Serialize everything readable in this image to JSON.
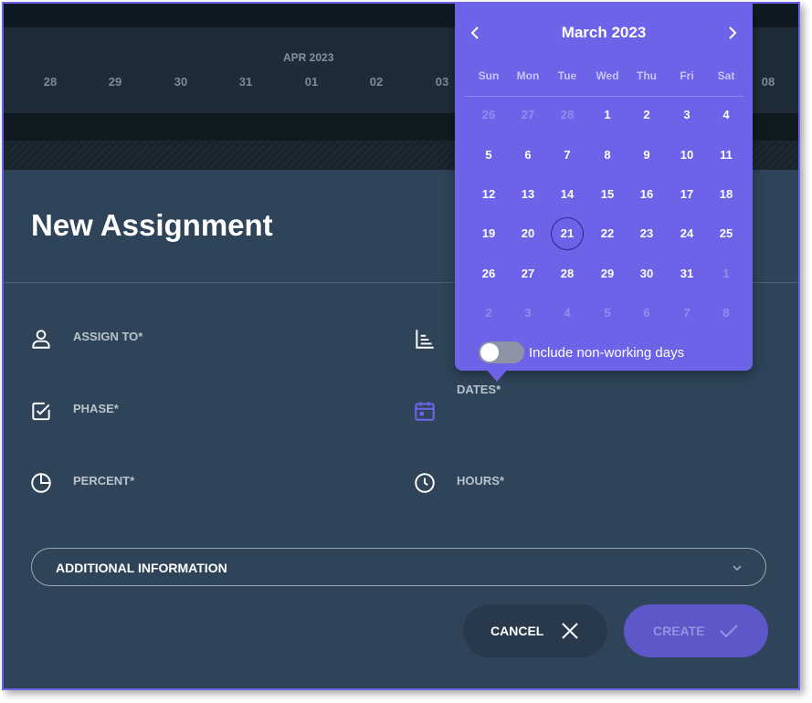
{
  "timeline": {
    "month": "APR 2023",
    "days": [
      "28",
      "29",
      "30",
      "31",
      "01",
      "02",
      "03",
      "08"
    ]
  },
  "form": {
    "title": "New Assignment",
    "fields": {
      "assign_to": "ASSIGN TO*",
      "phase": "PHASE*",
      "percent": "PERCENT*",
      "dates": "DATES*",
      "hours": "HOURS*"
    },
    "additional_info": "ADDITIONAL INFORMATION",
    "cancel_label": "CANCEL",
    "create_label": "CREATE"
  },
  "calendar": {
    "month_title": "March 2023",
    "weekdays": [
      "Sun",
      "Mon",
      "Tue",
      "Wed",
      "Thu",
      "Fri",
      "Sat"
    ],
    "weeks": [
      [
        {
          "d": "26",
          "m": true
        },
        {
          "d": "27",
          "m": true
        },
        {
          "d": "28",
          "m": true
        },
        {
          "d": "1"
        },
        {
          "d": "2"
        },
        {
          "d": "3"
        },
        {
          "d": "4"
        }
      ],
      [
        {
          "d": "5"
        },
        {
          "d": "6"
        },
        {
          "d": "7"
        },
        {
          "d": "8"
        },
        {
          "d": "9"
        },
        {
          "d": "10"
        },
        {
          "d": "11"
        }
      ],
      [
        {
          "d": "12"
        },
        {
          "d": "13"
        },
        {
          "d": "14"
        },
        {
          "d": "15"
        },
        {
          "d": "16"
        },
        {
          "d": "17"
        },
        {
          "d": "18"
        }
      ],
      [
        {
          "d": "19"
        },
        {
          "d": "20"
        },
        {
          "d": "21",
          "today": true
        },
        {
          "d": "22"
        },
        {
          "d": "23"
        },
        {
          "d": "24"
        },
        {
          "d": "25"
        }
      ],
      [
        {
          "d": "26"
        },
        {
          "d": "27"
        },
        {
          "d": "28"
        },
        {
          "d": "29"
        },
        {
          "d": "30"
        },
        {
          "d": "31"
        },
        {
          "d": "1",
          "m": true
        }
      ],
      [
        {
          "d": "2",
          "m": true
        },
        {
          "d": "3",
          "m": true
        },
        {
          "d": "4",
          "m": true
        },
        {
          "d": "5",
          "m": true
        },
        {
          "d": "6",
          "m": true
        },
        {
          "d": "7",
          "m": true
        },
        {
          "d": "8",
          "m": true
        }
      ]
    ],
    "toggle_label": "Include non-working days",
    "toggle_on": false
  },
  "colors": {
    "accent": "#6c63e8",
    "panel": "#2f4459",
    "create_button": "#5d58c9"
  }
}
